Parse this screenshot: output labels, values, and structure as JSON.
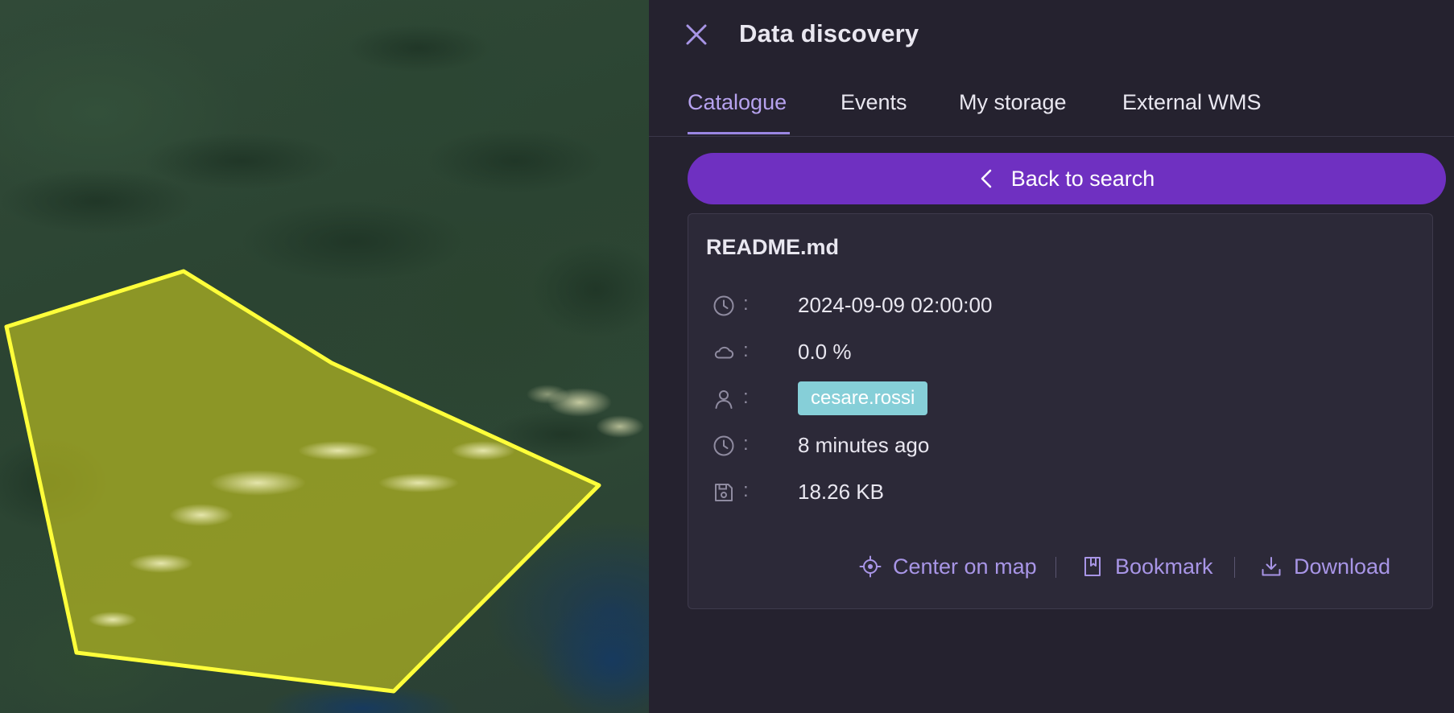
{
  "panel": {
    "title": "Data discovery",
    "close_icon": "close-icon"
  },
  "tabs": [
    {
      "label": "Catalogue",
      "active": true
    },
    {
      "label": "Events",
      "active": false
    },
    {
      "label": "My storage",
      "active": false
    },
    {
      "label": "External WMS",
      "active": false
    }
  ],
  "back_button": {
    "label": "Back to search",
    "icon": "chevron-left-icon"
  },
  "item": {
    "name": "README.md",
    "acquisition_date": "2024-09-09 02:00:00",
    "cloud_cover": "0.0 %",
    "owner": "cesare.rossi",
    "uploaded": "8 minutes ago",
    "size": "18.26 KB"
  },
  "actions": {
    "center_on_map": "Center on map",
    "bookmark": "Bookmark",
    "download": "Download"
  },
  "colors": {
    "accent": "#6f30c1",
    "tab_active": "#b6a2ee",
    "action_link": "#a895e6",
    "panel_bg": "#25222f",
    "card_bg": "#2c2938",
    "user_tag": "#86cfd8",
    "footprint_fill": "#c8c81e",
    "footprint_stroke": "#ffff3a"
  }
}
